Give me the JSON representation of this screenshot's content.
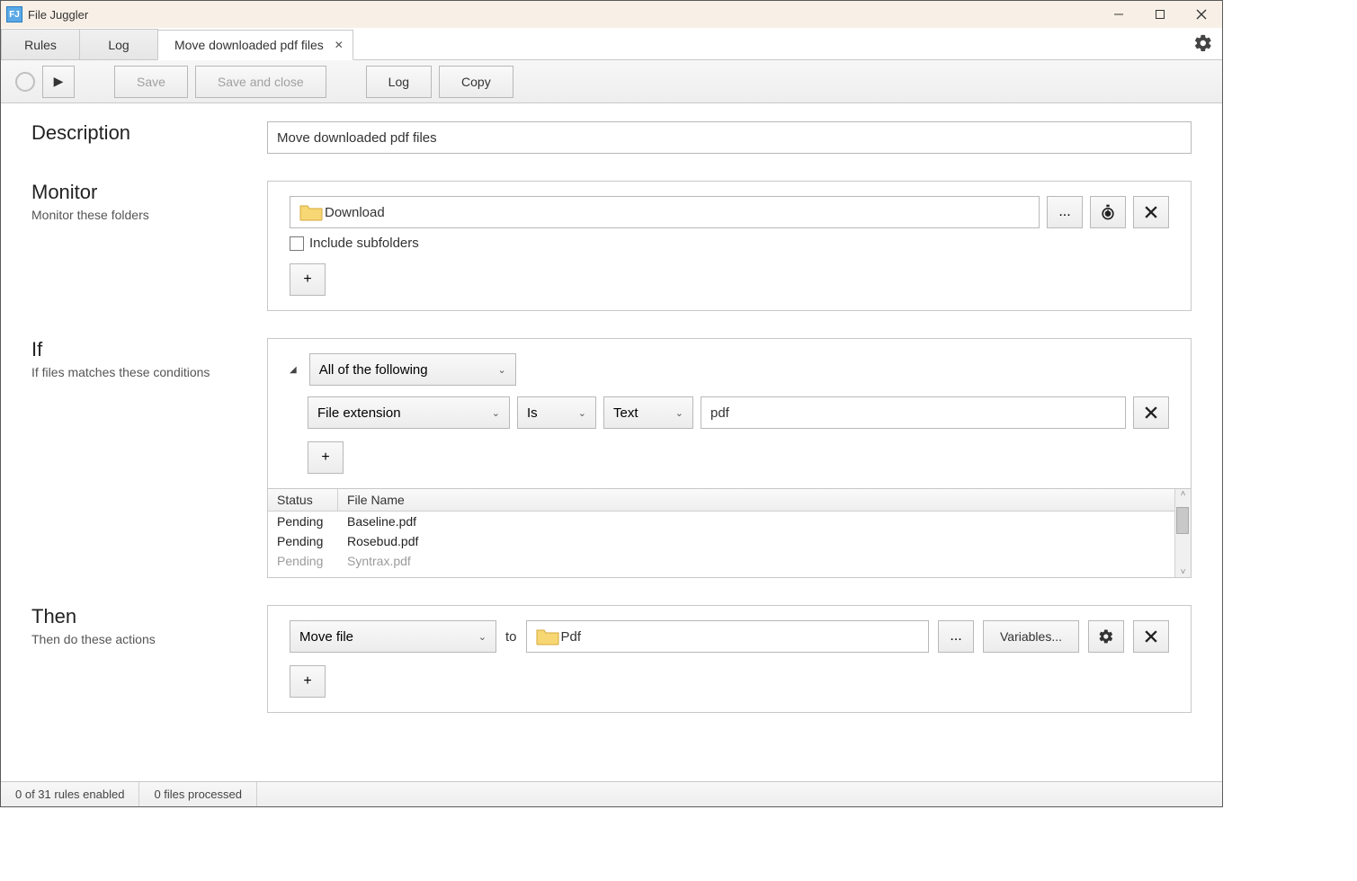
{
  "window": {
    "title": "File Juggler",
    "app_icon_text": "FJ"
  },
  "tabs": {
    "rules": "Rules",
    "log": "Log",
    "active": "Move downloaded pdf files"
  },
  "toolbar": {
    "play": "▶",
    "save": "Save",
    "save_close": "Save and close",
    "log": "Log",
    "copy": "Copy"
  },
  "description": {
    "heading": "Description",
    "value": "Move downloaded pdf files"
  },
  "monitor": {
    "heading": "Monitor",
    "sub": "Monitor these folders",
    "folder": "Download",
    "browse": "...",
    "include_sub": "Include subfolders",
    "add": "+"
  },
  "if_section": {
    "heading": "If",
    "sub": "If files matches these conditions",
    "match_mode": "All of the following",
    "prop": "File extension",
    "op": "Is",
    "type": "Text",
    "value": "pdf",
    "add": "+"
  },
  "table": {
    "col_status": "Status",
    "col_name": "File Name",
    "rows": [
      {
        "status": "Pending",
        "name": "Baseline.pdf"
      },
      {
        "status": "Pending",
        "name": "Rosebud.pdf"
      },
      {
        "status": "Pending",
        "name": "Syntrax.pdf"
      }
    ]
  },
  "then": {
    "heading": "Then",
    "sub": "Then do these actions",
    "action": "Move file",
    "to": "to",
    "folder": "Pdf",
    "browse": "...",
    "variables": "Variables...",
    "add": "+"
  },
  "status": {
    "rules": "0 of 31 rules enabled",
    "processed": "0 files processed"
  }
}
